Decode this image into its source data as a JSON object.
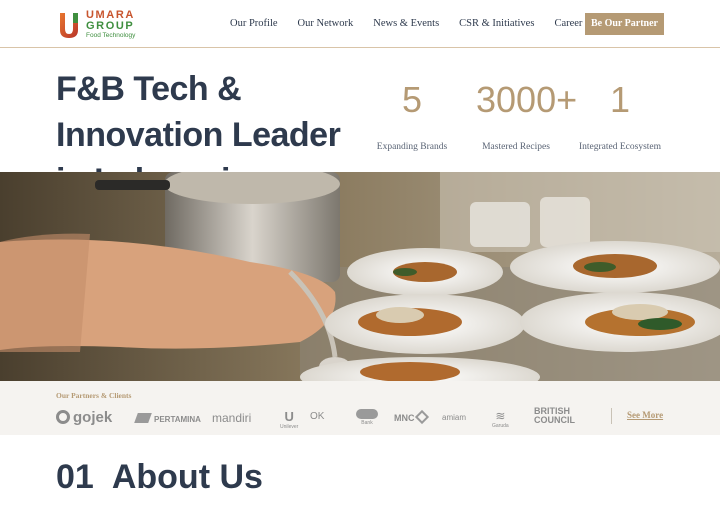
{
  "brand": {
    "name_line1": "UMARA",
    "name_line2": "GROUP",
    "tagline": "Food Technology",
    "colors": {
      "orange": "#c8552e",
      "green": "#3f8f3f",
      "accent": "#b59a74",
      "navy": "#2e3a4d"
    }
  },
  "nav": {
    "items": [
      "Our Profile",
      "Our Network",
      "News & Events",
      "CSR & Initiatives",
      "Career"
    ],
    "cta_label": "Be Our Partner"
  },
  "hero": {
    "title": "F&B Tech & Innovation Leader in Indonesia",
    "stats": [
      {
        "value": "5",
        "label": "Expanding Brands"
      },
      {
        "value": "3000+",
        "label": "Mastered Recipes"
      },
      {
        "value": "1",
        "label": "Integrated Ecosystem"
      }
    ]
  },
  "partners": {
    "title": "Our Partners & Clients",
    "logos": [
      "gojek",
      "PERTAMINA",
      "mandiri",
      "Unilever",
      "OK",
      "Bank",
      "MNC",
      "amiam",
      "Garuda",
      "BRITISH COUNCIL"
    ],
    "see_more_label": "See More"
  },
  "about": {
    "number": "01",
    "title": "About Us"
  }
}
